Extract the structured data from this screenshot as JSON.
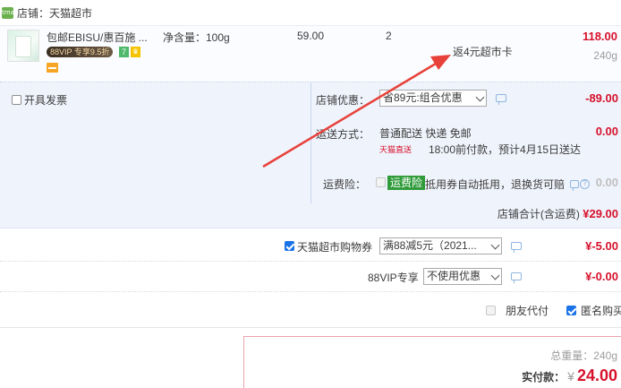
{
  "shop": {
    "icon_text": "tmall",
    "name": "店铺：天猫超市"
  },
  "item": {
    "title": "包邮EBISU/惠百施 ...",
    "vip_badge": "88VIP 专享9.5折",
    "badge_7": "7",
    "badge_g": "♛",
    "spec": "净含量：100g",
    "unit_price": "59.00",
    "quantity": "2",
    "promo": "返4元超市卡",
    "subtotal": "118.00",
    "weight": "240g"
  },
  "invoice": {
    "label": "开具发票"
  },
  "store_discount": {
    "label": "店铺优惠：",
    "selected": "省89元:组合优惠",
    "amount": "-89.00"
  },
  "delivery": {
    "label": "运送方式：",
    "method": "普通配送 快递 免邮",
    "amount": "0.00",
    "tmall_tag": "天猫直送",
    "eta": "18:00前付款，预计4月15日送达"
  },
  "insurance": {
    "label": "运费险：",
    "badge": "运费险",
    "text": "抵用券自动抵用，退换货可赔",
    "help": "?",
    "amount": "0.00"
  },
  "shop_total": {
    "label": "店铺合计(含运费)",
    "amount": "¥29.00"
  },
  "coupon": {
    "label": "天猫超市购物券",
    "selected": "满88减5元（2021...",
    "amount": "¥-5.00"
  },
  "vip88": {
    "label": "88VIP专享",
    "selected": "不使用优惠",
    "amount": "¥-0.00"
  },
  "options": {
    "friend_pay": "朋友代付",
    "anonymous": "匿名购买"
  },
  "summary": {
    "total_weight": "总重量：240g",
    "pay_label": "实付款：",
    "currency": "¥",
    "pay_amount": "24.00"
  },
  "colors": {
    "price_red": "#d7112c",
    "panel_bg": "#eff3fb",
    "annotation_arrow": "#e8413a",
    "insurance_green": "#2f9b3a"
  }
}
